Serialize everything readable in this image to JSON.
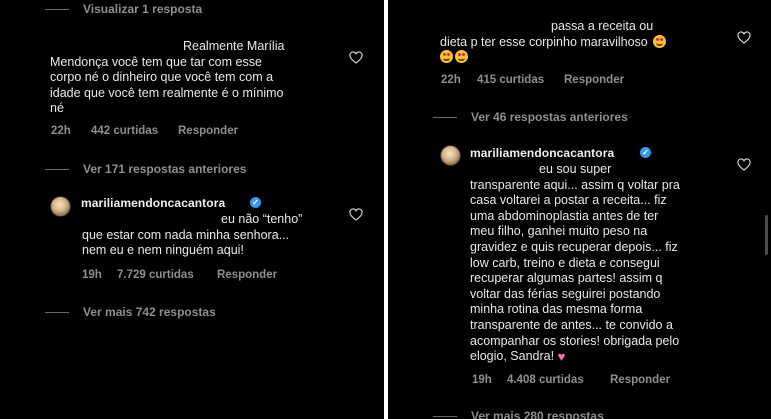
{
  "left": {
    "top_view_replies": "Visualizar 1 resposta",
    "comment1": {
      "lines": [
        "Realmente Marília",
        "Mendonça você tem que tar com esse",
        "corpo né o dinheiro que você tem com a",
        "idade que você tem realmente é o mínimo",
        "né"
      ],
      "time": "22h",
      "likes": "442 curtidas",
      "reply": "Responder"
    },
    "view_previous": "Ver 171 respostas anteriores",
    "reply1": {
      "username": "mariliamendoncacantora",
      "lines": [
        "eu não “tenho”",
        "que estar com nada minha senhora...",
        "nem eu e nem ninguém aqui!"
      ],
      "time": "19h",
      "likes": "7.729 curtidas",
      "reply": "Responder"
    },
    "view_more": "Ver mais 742 respostas"
  },
  "right": {
    "comment1": {
      "lines": [
        "passa a receita ou",
        "dieta p ter esse corpinho maravilhoso"
      ],
      "time": "22h",
      "likes": "415 curtidas",
      "reply": "Responder"
    },
    "view_previous": "Ver 46 respostas anteriores",
    "reply1": {
      "username": "mariliamendoncacantora",
      "lines": [
        "eu sou super",
        "transparente aqui... assim q voltar pra",
        "casa voltarei a postar a receita... fiz",
        "uma abdominoplastia antes de ter",
        "meu filho, ganhei muito peso na",
        "gravidez e quis recuperar depois... fiz",
        "low carb, treino e dieta e consegui",
        "recuperar algumas partes! assim q",
        "voltar das férias seguirei postando",
        "minha rotina das mesma forma",
        "transparente de antes... te convido a",
        "acompanhar os stories! obrigada pelo",
        "elogio, Sandra!"
      ],
      "time": "19h",
      "likes": "4.408 curtidas",
      "reply": "Responder"
    },
    "view_more": "Ver mais 280 respostas"
  },
  "icons": {
    "heart": "heart-outline-icon",
    "verified": "verified-badge-icon",
    "emoji": "heart-eyes-emoji-icon",
    "sparkling_heart": "sparkling-heart-emoji-icon"
  },
  "colors": {
    "background": "#000000",
    "text": "#e8e8e8",
    "muted": "#8e8e8e",
    "verified": "#3897f0"
  }
}
